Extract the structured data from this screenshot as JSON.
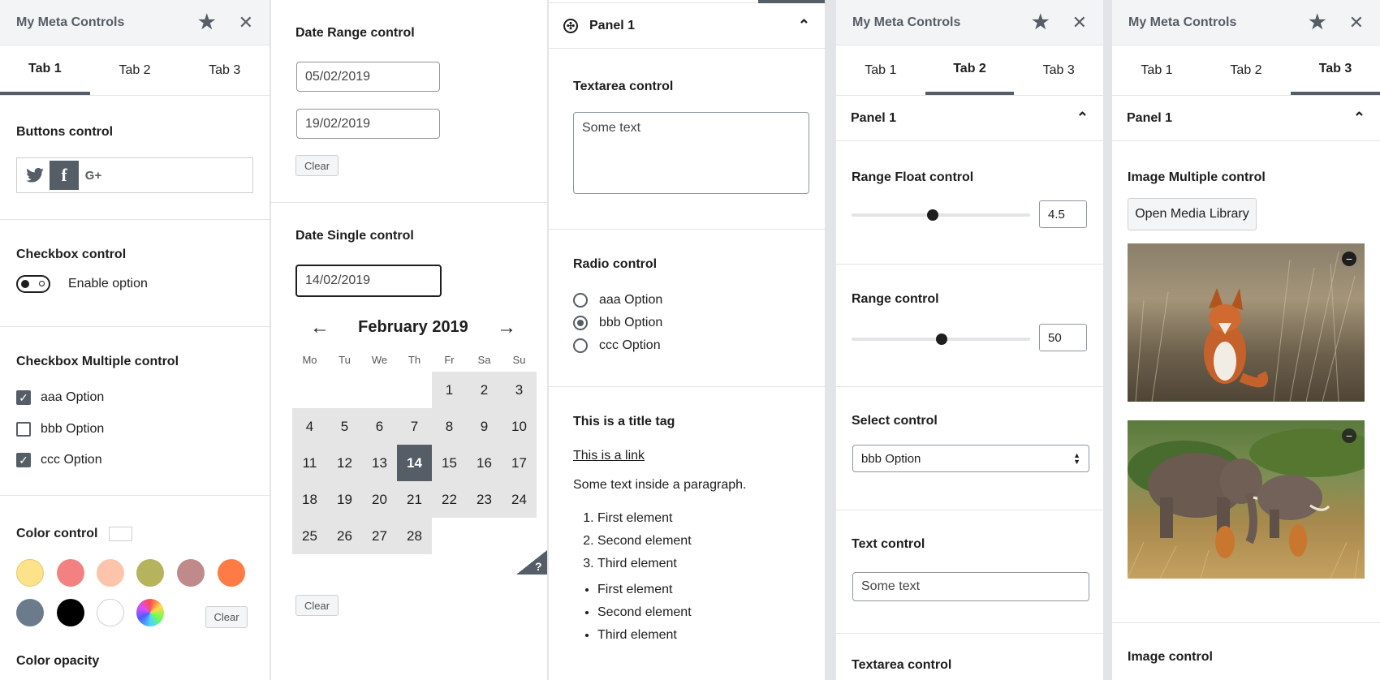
{
  "col1": {
    "title": "My Meta Controls",
    "tabs": [
      "Tab 1",
      "Tab 2",
      "Tab 3"
    ],
    "buttons_label": "Buttons control",
    "checkbox_label": "Checkbox control",
    "toggle_text": "Enable option",
    "checkbox_multi_label": "Checkbox Multiple control",
    "options": [
      {
        "label": "aaa Option",
        "checked": true
      },
      {
        "label": "bbb Option",
        "checked": false
      },
      {
        "label": "ccc Option",
        "checked": true
      }
    ],
    "color_label": "Color control",
    "swatches": [
      "#fce38a",
      "#f38181",
      "#fbc4ab",
      "#b5b35c",
      "#c08a8a",
      "#ff7b45",
      "#6b7b8c",
      "#000000",
      "#ffffff"
    ],
    "clear": "Clear",
    "color_opacity_label": "Color opacity"
  },
  "col2": {
    "date_range_label": "Date Range control",
    "date_from": "05/02/2019",
    "date_to": "19/02/2019",
    "clear": "Clear",
    "date_single_label": "Date Single control",
    "date_single": "14/02/2019",
    "month": "February 2019",
    "weekdays": [
      "Mo",
      "Tu",
      "We",
      "Th",
      "Fr",
      "Sa",
      "Su"
    ],
    "help": "?",
    "clear2": "Clear"
  },
  "col3": {
    "panel": "Panel 1",
    "textarea_label": "Textarea control",
    "textarea_value": "Some text",
    "radio_label": "Radio control",
    "radios": [
      {
        "label": "aaa Option",
        "on": false
      },
      {
        "label": "bbb Option",
        "on": true
      },
      {
        "label": "ccc Option",
        "on": false
      }
    ],
    "title_tag": "This is a title tag",
    "link": "This is a link",
    "paragraph": "Some text inside a paragraph.",
    "ordered": [
      "First element",
      "Second element",
      "Third element"
    ],
    "unordered": [
      "First element",
      "Second element",
      "Third element"
    ]
  },
  "col4": {
    "title": "My Meta Controls",
    "tabs": [
      "Tab 1",
      "Tab 2",
      "Tab 3"
    ],
    "panel": "Panel 1",
    "range_float_label": "Range Float control",
    "range_float_value": "4.5",
    "range_label": "Range control",
    "range_value": "50",
    "select_label": "Select control",
    "select_value": "bbb Option",
    "text_label": "Text control",
    "text_value": "Some text",
    "textarea_label": "Textarea control"
  },
  "col5": {
    "title": "My Meta Controls",
    "tabs": [
      "Tab 1",
      "Tab 2",
      "Tab 3"
    ],
    "panel": "Panel 1",
    "image_multi_label": "Image Multiple control",
    "open_media": "Open Media Library",
    "image_label": "Image control"
  }
}
